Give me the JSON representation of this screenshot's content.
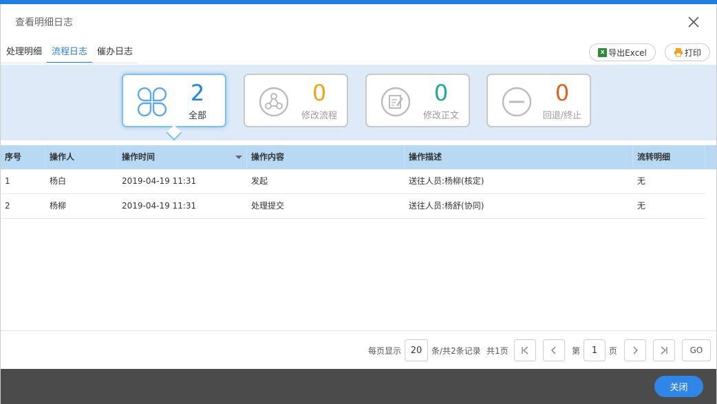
{
  "dialog": {
    "title": "查看明细日志",
    "close_icon": "close-icon"
  },
  "tabs": [
    {
      "label": "处理明细",
      "active": false
    },
    {
      "label": "流程日志",
      "active": true
    },
    {
      "label": "催办日志",
      "active": false
    }
  ],
  "toolbar": {
    "export_icon_text": "x",
    "export_label": "导出Excel",
    "print_label": "打印"
  },
  "stats": [
    {
      "count": "2",
      "label": "全部",
      "icon": "clover-icon",
      "color": "#1c86e0",
      "active": true
    },
    {
      "count": "0",
      "label": "修改流程",
      "icon": "workflow-icon",
      "color": "#f3a21b",
      "active": false
    },
    {
      "count": "0",
      "label": "修改正文",
      "icon": "edit-document-icon",
      "color": "#1aa99a",
      "active": false
    },
    {
      "count": "0",
      "label": "回退/终止",
      "icon": "minus-circle-icon",
      "color": "#e06020",
      "active": false
    }
  ],
  "table": {
    "columns": [
      "序号",
      "操作人",
      "操作时间",
      "操作内容",
      "操作描述",
      "流转明细"
    ],
    "rows": [
      [
        "1",
        "杨白",
        "2019-04-19 11:31",
        "发起",
        "送往人员:杨柳(核定)",
        "无"
      ],
      [
        "2",
        "杨柳",
        "2019-04-19 11:31",
        "处理提交",
        "送往人员:杨舒(协同)",
        "无"
      ]
    ]
  },
  "pager": {
    "per_page_label": "每页显示",
    "per_page_value": "20",
    "records_label": "条/共2条记录",
    "pages_label": "共1页",
    "page_prefix": "第",
    "page_value": "1",
    "page_suffix": "页",
    "go_label": "GO"
  },
  "footer": {
    "close_label": "关闭"
  },
  "colors": {
    "accent": "#2a7fd4",
    "header_row": "#b7d9f4",
    "stats_bg": "#deeaf7",
    "footer_bar": "#4b4b4b",
    "close_button": "#2f86e6"
  }
}
